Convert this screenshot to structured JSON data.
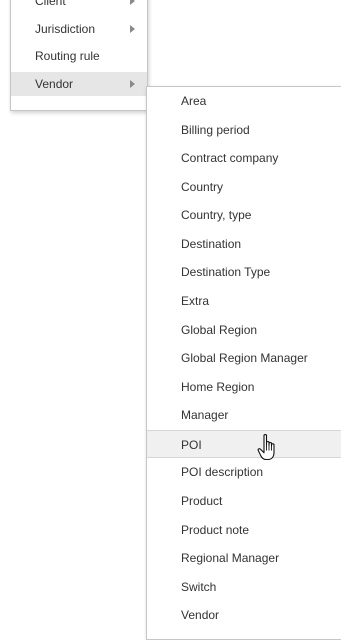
{
  "parent_menu": {
    "items": [
      {
        "label": "Client",
        "has_submenu": true
      },
      {
        "label": "Jurisdiction",
        "has_submenu": true
      },
      {
        "label": "Routing rule",
        "has_submenu": false
      },
      {
        "label": "Vendor",
        "has_submenu": true,
        "active": true
      }
    ]
  },
  "sub_menu": {
    "items": [
      {
        "label": "Area"
      },
      {
        "label": "Billing period"
      },
      {
        "label": "Contract company"
      },
      {
        "label": "Country"
      },
      {
        "label": "Country, type"
      },
      {
        "label": "Destination"
      },
      {
        "label": "Destination Type"
      },
      {
        "label": "Extra"
      },
      {
        "label": "Global Region"
      },
      {
        "label": "Global Region Manager"
      },
      {
        "label": "Home Region"
      },
      {
        "label": "Manager"
      },
      {
        "label": "POI",
        "hovered": true
      },
      {
        "label": "POI description"
      },
      {
        "label": "Product"
      },
      {
        "label": "Product note"
      },
      {
        "label": "Regional Manager"
      },
      {
        "label": "Switch"
      },
      {
        "label": "Vendor"
      }
    ]
  },
  "cursor": {
    "icon": "hand-pointer-icon"
  },
  "colors": {
    "hover_bg": "#f0f0f0",
    "active_bg": "#e6e6e6",
    "border": "#c6c6c6"
  }
}
